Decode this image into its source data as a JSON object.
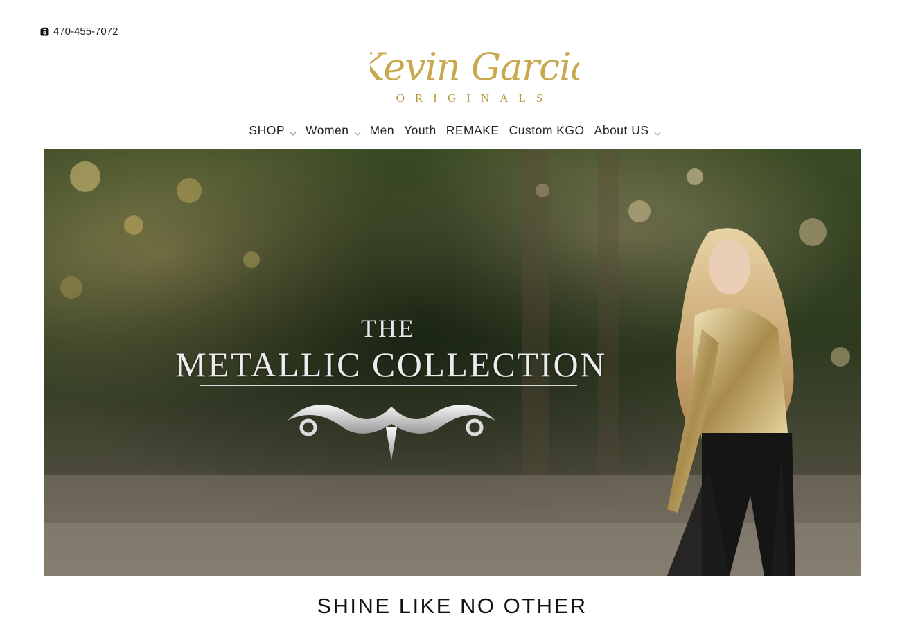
{
  "top_bar": {
    "phone": "470-455-7072",
    "phone_icon": "phone-icon"
  },
  "logo": {
    "line1": "Kevin Garcia",
    "line2": "ORIGINALS",
    "color": "#c9a94f"
  },
  "nav": {
    "items": [
      {
        "label": "SHOP",
        "dropdown": true
      },
      {
        "label": "Women",
        "dropdown": true
      },
      {
        "label": "Men",
        "dropdown": false
      },
      {
        "label": "Youth",
        "dropdown": false
      },
      {
        "label": "REMAKE",
        "dropdown": false
      },
      {
        "label": "Custom KGO",
        "dropdown": false
      },
      {
        "label": "About US",
        "dropdown": true
      }
    ]
  },
  "hero": {
    "the": "THE",
    "title": "METALLIC COLLECTION"
  },
  "tagline": "SHINE LIKE NO OTHER",
  "colors": {
    "accent_gold": "#c9a94f",
    "pink_mark": "#e0359a"
  }
}
